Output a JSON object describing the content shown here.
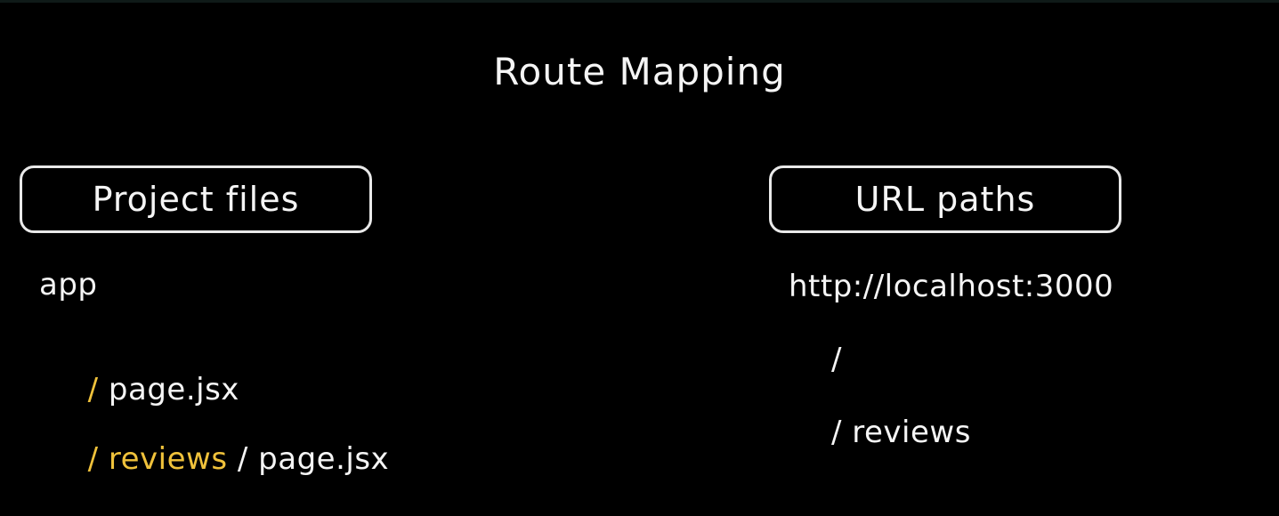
{
  "title": "Route Mapping",
  "colors": {
    "background": "#000000",
    "text": "#f5f5f5",
    "accent": "#f0c23b"
  },
  "left": {
    "header": "Project files",
    "root": "app",
    "rows": [
      {
        "sep1": "/",
        "segment": "",
        "sep2": "",
        "file": "page.jsx"
      },
      {
        "sep1": "/",
        "segment": "reviews",
        "sep2": "/",
        "file": "page.jsx"
      }
    ]
  },
  "right": {
    "header": "URL paths",
    "base": "http://localhost:3000",
    "paths": [
      "/",
      "/ reviews"
    ]
  }
}
